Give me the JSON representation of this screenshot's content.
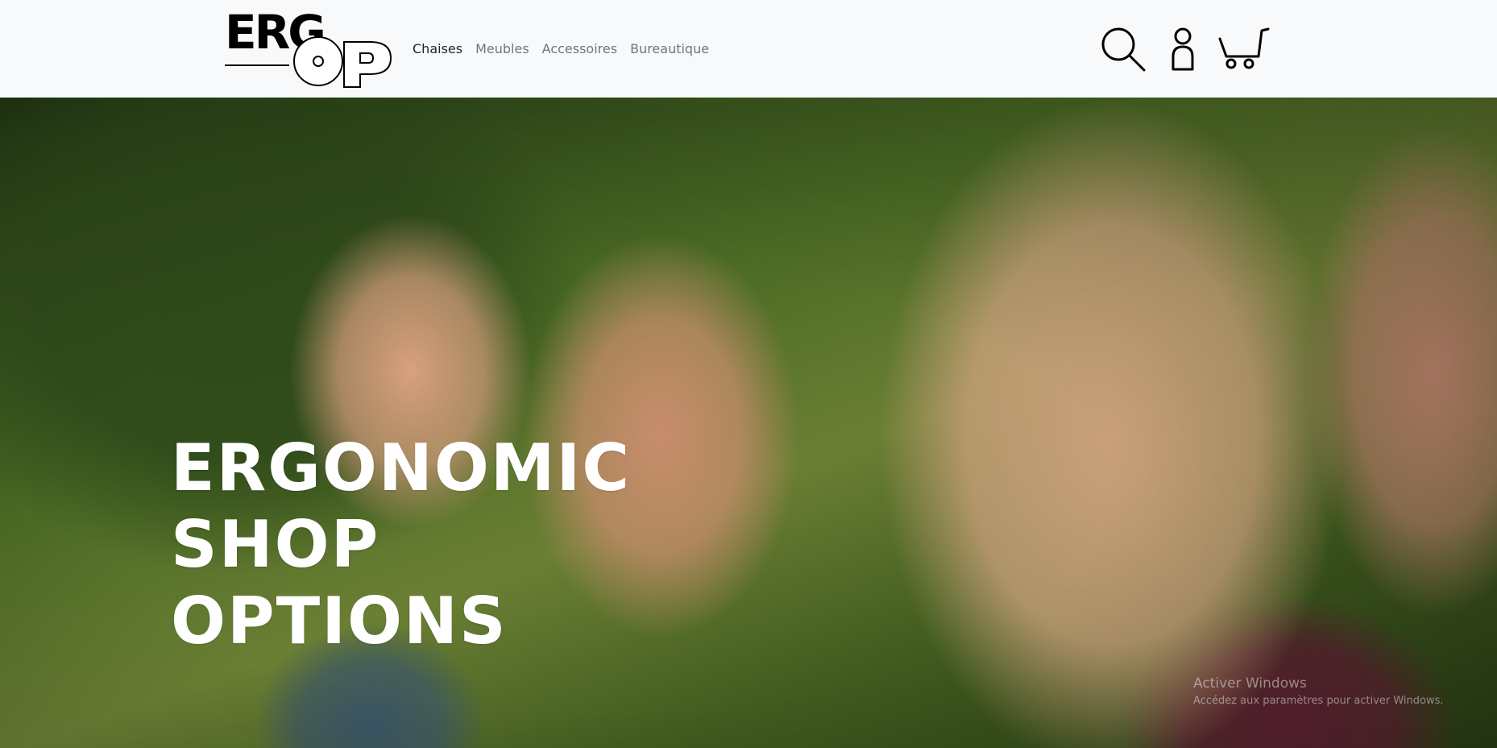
{
  "logo": {
    "line1": "ERG",
    "line2": "OP"
  },
  "nav": {
    "links": [
      "Chaises",
      "Meubles",
      "Accessoires",
      "Bureautique"
    ],
    "active_index": 0
  },
  "icons": {
    "search": "search-icon",
    "account": "user-icon",
    "cart": "cart-icon"
  },
  "hero": {
    "lines": [
      "ERGONOMIC",
      "SHOP",
      "OPTIONS"
    ]
  },
  "watermark": {
    "title": "Activer Windows",
    "subtitle": "Accédez aux paramètres pour activer Windows."
  },
  "colors": {
    "navbar_bg": "#f8f9fa",
    "nav_text": "#6c757d",
    "nav_active": "#212529",
    "hero_text": "#ffffff"
  }
}
